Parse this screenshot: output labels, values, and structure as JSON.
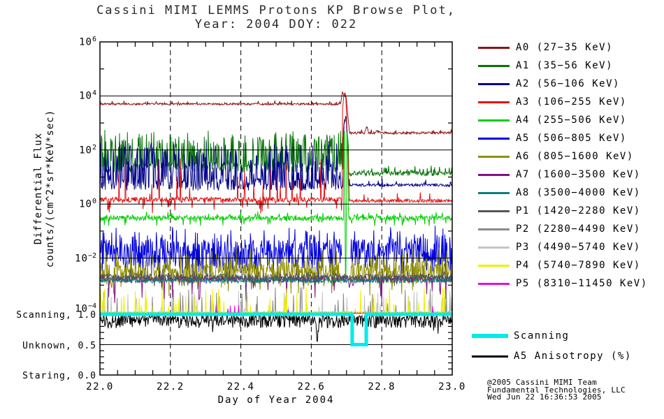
{
  "title": {
    "line1": "Cassini MIMI LEMMS Protons KP Browse Plot,",
    "line2": "Year: 2004 DOY: 022"
  },
  "credits": {
    "line1": "@2005 Cassini MIMI Team",
    "line2": "Fundamental Technologies, LLC",
    "line3": "Wed Jun 22 16:36:53 2005"
  },
  "chart_data": {
    "type": "line",
    "x_axis": {
      "label": "Day of Year 2004",
      "range": [
        22.0,
        23.0
      ],
      "ticks": [
        {
          "label": "22.0",
          "value": 22.0
        },
        {
          "label": "22.2",
          "value": 22.2
        },
        {
          "label": "22.4",
          "value": 22.4
        },
        {
          "label": "22.6",
          "value": 22.6
        },
        {
          "label": "22.8",
          "value": 22.8
        },
        {
          "label": "23.0",
          "value": 23.0
        }
      ],
      "minor_tick_step": 0.05,
      "gridlines": [
        22.2,
        22.4,
        22.6,
        22.8
      ],
      "gridline_style": "dashed"
    },
    "y_axis": {
      "label_line1": "Differential Flux",
      "label_line2": "counts/(cm^2*sr*KeV*sec)",
      "scale": "log",
      "range_log": [
        -4,
        6
      ],
      "ticks": [
        {
          "base": "10",
          "exp": "6",
          "log": 6
        },
        {
          "base": "10",
          "exp": "4",
          "log": 4
        },
        {
          "base": "10",
          "exp": "2",
          "log": 2
        },
        {
          "base": "10",
          "exp": "0",
          "log": 0
        },
        {
          "base": "10",
          "exp": "−2",
          "log": -2
        },
        {
          "base": "10",
          "exp": "−4",
          "log": -4
        }
      ],
      "gridlines_log": [
        4,
        2,
        0,
        -2
      ]
    },
    "event_time": 22.7,
    "series": [
      {
        "id": "A0",
        "label": "A0 (27−35 KeV)",
        "color": "#8b1414",
        "pre": {
          "base": 3.7,
          "noise": 0.035,
          "spike_p": 0.06,
          "spike_amp": 0.12
        },
        "post": {
          "base": 2.63,
          "noise": 0.045,
          "spike_p": 0.05,
          "spike_amp": 0.1
        },
        "split": 22.708,
        "event": [
          [
            22.684,
            3.75
          ],
          [
            22.688,
            4.18
          ],
          [
            22.692,
            4.0
          ],
          [
            22.696,
            4.12
          ],
          [
            22.7,
            3.85
          ],
          [
            22.704,
            3.2
          ],
          [
            22.708,
            2.75
          ]
        ],
        "bumps": [
          {
            "x": 22.757,
            "w": 0.006,
            "amp": 0.28
          },
          {
            "x": 22.79,
            "w": 0.012,
            "amp": 0.07
          }
        ]
      },
      {
        "id": "A1",
        "label": "A1 (35−56 KeV)",
        "color": "#077307",
        "pre": {
          "base": 1.35,
          "noise": 0.18,
          "spike_p": 0.5,
          "spike_amp": 1.25
        },
        "post": {
          "base": 1.13,
          "noise": 0.09,
          "spike_p": 0.12,
          "spike_amp": 0.25
        },
        "split": 22.706,
        "event": [
          [
            22.69,
            2.6
          ],
          [
            22.694,
            3.15
          ],
          [
            22.7,
            3.05
          ],
          [
            22.706,
            2.0
          ]
        ]
      },
      {
        "id": "A2",
        "label": "A2 (56−106 KeV)",
        "color": "#00008b",
        "pre": {
          "base": 0.72,
          "noise": 0.22,
          "spike_p": 0.42,
          "spike_amp": 1.45
        },
        "post": {
          "base": 0.7,
          "noise": 0.05,
          "spike_p": 0.04,
          "spike_amp": 0.25
        },
        "split": 22.704,
        "event": [
          [
            22.692,
            2.9
          ],
          [
            22.699,
            3.3
          ],
          [
            22.704,
            1.5
          ]
        ]
      },
      {
        "id": "A3",
        "label": "A3 (106−255 KeV)",
        "color": "#e31212",
        "pre": {
          "base": 0.17,
          "noise": 0.1,
          "spike_p": 0.06,
          "spike_amp": 1.6,
          "dip_p": 0.12,
          "dip_amp": 0.45
        },
        "post": {
          "base": 0.12,
          "noise": 0.06,
          "spike_p": 0.02,
          "spike_amp": 0.3
        },
        "split": 22.707,
        "event": [
          [
            22.688,
            3.3
          ],
          [
            22.692,
            4.05
          ],
          [
            22.698,
            3.95
          ],
          [
            22.703,
            2.2
          ],
          [
            22.707,
            0.6
          ]
        ]
      },
      {
        "id": "A4",
        "label": "A4 (255−506 KeV)",
        "color": "#00d000",
        "pre": {
          "base": -0.52,
          "noise": 0.09,
          "spike_p": 0.1,
          "spike_amp": 0.18,
          "dip_p": 0.08,
          "dip_amp": 0.3
        },
        "event": [
          [
            22.6915,
            0.5
          ],
          [
            22.6935,
            3.68
          ],
          [
            22.6975,
            -3.95
          ],
          [
            22.7015,
            3.58
          ],
          [
            22.7055,
            -0.5
          ]
        ]
      },
      {
        "id": "A5",
        "label": "A5 (506−805 KeV)",
        "color": "#0000e0",
        "pre": {
          "base": -1.85,
          "noise": 0.55,
          "spike_p": 0.35,
          "spike_amp": 0.55,
          "dip_p": 0.3,
          "dip_amp": 0.6
        },
        "gap": [
          22.687,
          22.712
        ]
      },
      {
        "id": "A6",
        "label": "A6 (805−1600 KeV)",
        "color": "#8f8f00",
        "pre": {
          "base": -2.55,
          "noise": 0.38,
          "spike_p": 0.25,
          "spike_amp": 0.65,
          "dip_p": 0.2,
          "dip_amp": 0.5
        },
        "gap": [
          22.687,
          22.712
        ]
      },
      {
        "id": "A7",
        "label": "A7 (1600−3500 KeV)",
        "color": "#821282",
        "pre": {
          "base": -2.78,
          "noise": 0.12,
          "spike_p": 0.05,
          "spike_amp": 0.15,
          "dip_p": 0.05,
          "dip_amp": 0.9
        },
        "event": [
          [
            22.703,
            -2.7
          ],
          [
            22.708,
            -3.1
          ],
          [
            22.713,
            -2.75
          ],
          [
            22.718,
            -3.05
          ],
          [
            22.723,
            -2.8
          ]
        ]
      },
      {
        "id": "A8",
        "label": "A8 (3500−4000 KeV)",
        "color": "#0e7d7d",
        "pre": {
          "base": -2.82,
          "noise": 0.1,
          "spike_p": 0.02,
          "spike_amp": 0.1
        }
      },
      {
        "id": "P1",
        "label": "P1 (1420−2280 KeV)",
        "color": "#565656",
        "pre": {
          "base": -2.7,
          "noise": 0.11,
          "spike_p": 0.08,
          "spike_amp": 0.2,
          "dip_p": 0.05,
          "dip_amp": 0.3
        }
      },
      {
        "id": "P2",
        "label": "P2 (2280−4490 KeV)",
        "color": "#8a8a8a",
        "pre": {
          "base": -4.03,
          "noise": 0.05,
          "spike_p": 0.07,
          "spike_amp": 0.95
        }
      },
      {
        "id": "P3",
        "label": "P3 (4490−5740 KeV)",
        "color": "#c6c6c6",
        "pre": {
          "base": -4.03,
          "noise": 0.05,
          "spike_p": 0.06,
          "spike_amp": 0.8
        }
      },
      {
        "id": "P4",
        "label": "P4 (5740−7890 KeV)",
        "color": "#f0f000",
        "pre": {
          "base": -4.03,
          "noise": 0.05,
          "spike_p": 0.08,
          "spike_amp": 1.0
        }
      },
      {
        "id": "P5",
        "label": "P5 (8310−11450 KeV)",
        "color": "#e011e0",
        "pre": {
          "base": -4.05,
          "noise": 0.03,
          "spike_p": 0.015,
          "spike_amp": 0.35
        }
      }
    ],
    "bottom_panel": {
      "mode_labels": [
        {
          "label": "Scanning, 1.0",
          "value": 1.0
        },
        {
          "label": "Unknown, 0.5",
          "value": 0.5
        },
        {
          "label": "Staring, 0.0",
          "value": 0.0
        }
      ],
      "gridline_value": 0.5,
      "scanning": {
        "legend_label": "Scanning",
        "color": "#00ebeb",
        "segments": [
          [
            22.0,
            22.716,
            1.0
          ],
          [
            22.716,
            22.756,
            0.5
          ],
          [
            22.756,
            23.0,
            1.0
          ]
        ]
      },
      "anisotropy": {
        "legend_label": "A5 Anisotropy (%)",
        "color": "#000000",
        "typical": 0.93,
        "range": [
          0.57,
          1.0
        ],
        "deep_dip_at": 22.617
      }
    }
  }
}
